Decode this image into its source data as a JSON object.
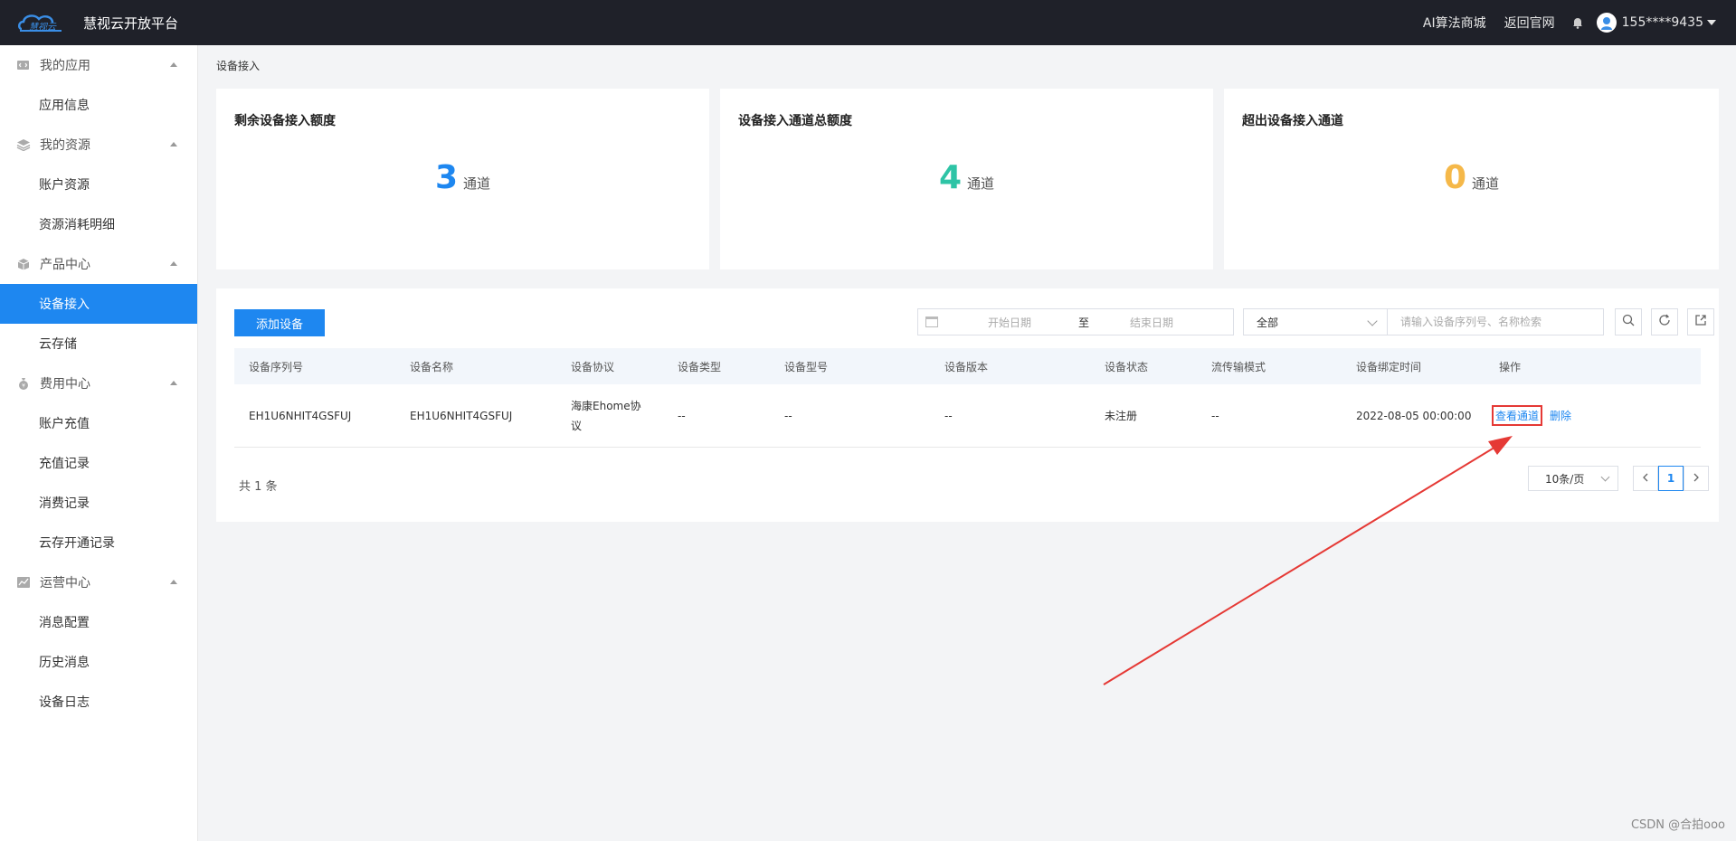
{
  "header": {
    "brand_logo_text": "慧视云",
    "brand_title": "慧视云开放平台",
    "links": [
      "AI算法商城",
      "返回官网"
    ],
    "user": "155****9435"
  },
  "sidebar": {
    "groups": [
      {
        "label": "我的应用",
        "icon": "app-icon",
        "items": [
          "应用信息"
        ]
      },
      {
        "label": "我的资源",
        "icon": "layers-icon",
        "items": [
          "账户资源",
          "资源消耗明细"
        ]
      },
      {
        "label": "产品中心",
        "icon": "box-icon",
        "items": [
          "设备接入",
          "云存储"
        ]
      },
      {
        "label": "费用中心",
        "icon": "money-bag-icon",
        "items": [
          "账户充值",
          "充值记录",
          "消费记录",
          "云存开通记录"
        ]
      },
      {
        "label": "运营中心",
        "icon": "chart-icon",
        "items": [
          "消息配置",
          "历史消息",
          "设备日志"
        ]
      }
    ],
    "active_item": "设备接入"
  },
  "breadcrumb": "设备接入",
  "stats": [
    {
      "title": "剩余设备接入额度",
      "value": "3",
      "unit": "通道",
      "color": "#1e87f0"
    },
    {
      "title": "设备接入通道总额度",
      "value": "4",
      "unit": "通道",
      "color": "#2ec4a6"
    },
    {
      "title": "超出设备接入通道",
      "value": "0",
      "unit": "通道",
      "color": "#f5b849"
    }
  ],
  "toolbar": {
    "add_label": "添加设备",
    "start_placeholder": "开始日期",
    "range_sep": "至",
    "end_placeholder": "结束日期",
    "filter_value": "全部",
    "search_placeholder": "请输入设备序列号、名称检索"
  },
  "table": {
    "columns": [
      "设备序列号",
      "设备名称",
      "设备协议",
      "设备类型",
      "设备型号",
      "设备版本",
      "设备状态",
      "流传输模式",
      "设备绑定时间",
      "操作"
    ],
    "rows": [
      {
        "serial": "EH1U6NHIT4GSFUJ",
        "name": "EH1U6NHIT4GSFUJ",
        "protocol": "海康Ehome协议",
        "type": "--",
        "model": "--",
        "version": "--",
        "status": "未注册",
        "stream_mode": "--",
        "bind_time": "2022-08-05 00:00:00",
        "op_view": "查看通道",
        "op_delete": "删除"
      }
    ]
  },
  "pagination": {
    "total_text": "共 1 条",
    "page_size": "10条/页",
    "current_page": "1"
  },
  "watermark": "CSDN @合拍ooo",
  "annotation_color": "#e53935"
}
